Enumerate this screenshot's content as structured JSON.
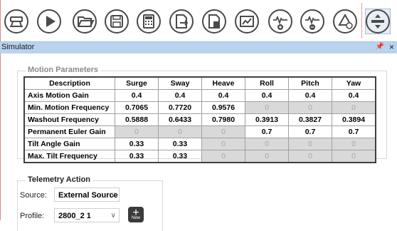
{
  "toolbar": {
    "buttons": [
      {
        "icon": "motion-rig-icon",
        "active": false
      },
      {
        "icon": "play-icon",
        "active": false
      },
      {
        "icon": "open-folder-icon",
        "active": false
      },
      {
        "icon": "save-icon",
        "active": false
      },
      {
        "icon": "calculator-icon",
        "active": false
      },
      {
        "icon": "export-icon",
        "active": false
      },
      {
        "icon": "save-document-icon",
        "active": false
      },
      {
        "icon": "chart-icon",
        "active": false
      },
      {
        "icon": "waveform-add-icon",
        "active": false
      },
      {
        "icon": "waveform-remove-icon",
        "active": false
      },
      {
        "icon": "triangle-refresh-icon",
        "active": false
      },
      {
        "icon": "vertical-move-icon",
        "active": true
      }
    ]
  },
  "window": {
    "title": "Simulator",
    "pin_glyph": "Ն",
    "close_glyph": "×"
  },
  "motion": {
    "group_title": "Motion Parameters",
    "headers": [
      "Description",
      "Surge",
      "Sway",
      "Heave",
      "Roll",
      "Pitch",
      "Yaw"
    ],
    "rows": [
      {
        "label": "Axis Motion Gain",
        "values": [
          "0.4",
          "0.4",
          "0.4",
          "0.4",
          "0.4",
          "0.4"
        ],
        "enabled": [
          true,
          true,
          true,
          true,
          true,
          true
        ]
      },
      {
        "label": "Min. Motion Frequency",
        "values": [
          "0.7065",
          "0.7720",
          "0.9576",
          "0",
          "0",
          "0"
        ],
        "enabled": [
          true,
          true,
          true,
          false,
          false,
          false
        ]
      },
      {
        "label": "Washout Frequency",
        "values": [
          "0.5888",
          "0.6433",
          "0.7980",
          "0.3913",
          "0.3827",
          "0.3894"
        ],
        "enabled": [
          true,
          true,
          true,
          true,
          true,
          true
        ]
      },
      {
        "label": "Permanent Euler Gain",
        "values": [
          "0",
          "0",
          "0",
          "0.7",
          "0.7",
          "0.7"
        ],
        "enabled": [
          false,
          false,
          false,
          true,
          true,
          true
        ]
      },
      {
        "label": "Tilt Angle Gain",
        "values": [
          "0.33",
          "0.33",
          "0",
          "0",
          "0",
          "0"
        ],
        "enabled": [
          true,
          true,
          false,
          false,
          false,
          false
        ]
      },
      {
        "label": "Max. Tilt Frequency",
        "values": [
          "0.33",
          "0.33",
          "0",
          "0",
          "0",
          "0"
        ],
        "enabled": [
          true,
          true,
          false,
          false,
          false,
          false
        ]
      }
    ]
  },
  "telemetry": {
    "group_title": "Telemetry Action",
    "source_label": "Source:",
    "source_value": "External Source",
    "profile_label": "Profile:",
    "profile_value": "2800_2 1",
    "add_glyph": "+",
    "add_sub": "New"
  },
  "colors": {
    "toolbar_icon": "#4a4a4a",
    "active_border": "#6b8fb5",
    "titlebar": "#b9d3ee",
    "disabled_cell": "#d9d9d9"
  }
}
